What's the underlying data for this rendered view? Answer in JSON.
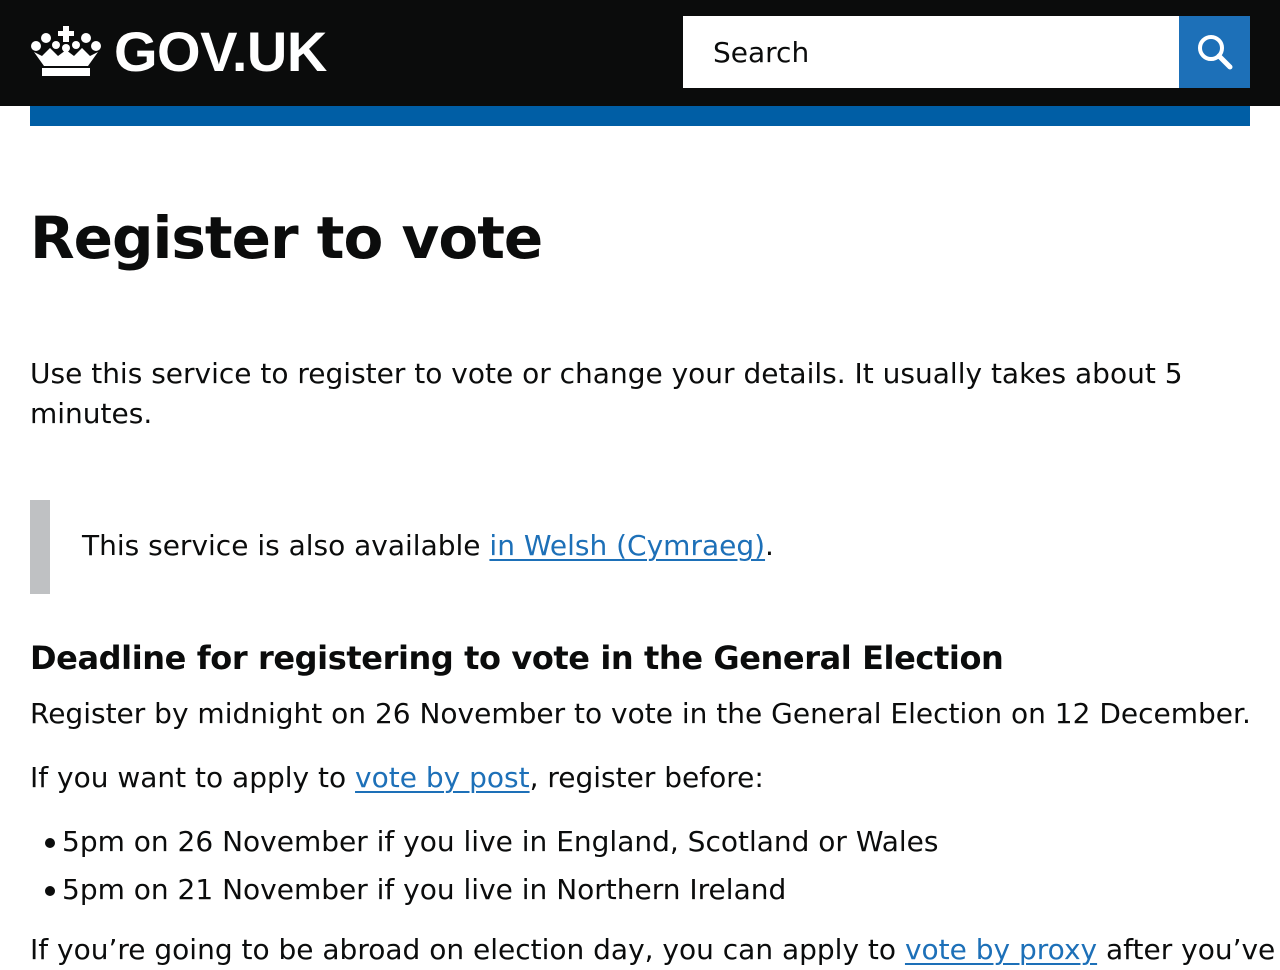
{
  "header": {
    "logo_text": "GOV.UK",
    "logo_icon": "crown-icon",
    "search_placeholder": "Search",
    "search_button_icon": "search-icon"
  },
  "main": {
    "title": "Register to vote",
    "lead": "Use this service to register to vote or change your details. It usually takes about 5 minutes.",
    "inset": {
      "text_before": "This service is also available ",
      "link_text": "in Welsh (Cymraeg)",
      "text_after": "."
    },
    "deadline_heading": "Deadline for registering to vote in the General Election",
    "deadline_text": "Register by midnight on 26 November to vote in the General Election on 12 December.",
    "post": {
      "text_before": "If you want to apply to ",
      "link_text": "vote by post",
      "text_after": ", register before:"
    },
    "bullets": [
      "5pm on 26 November if you live in England, Scotland or Wales",
      "5pm on 21 November if you live in Northern Ireland"
    ],
    "proxy": {
      "text_before": "If you’re going to be abroad on election day, you can apply to ",
      "link_text": "vote by proxy",
      "text_after": " after you’ve"
    }
  },
  "colors": {
    "header_bg": "#0b0c0c",
    "search_button": "#1d70b8",
    "blue_bar": "#005ea5",
    "link": "#1d70b8",
    "inset_border": "#bfc1c3",
    "text": "#0b0c0c"
  }
}
